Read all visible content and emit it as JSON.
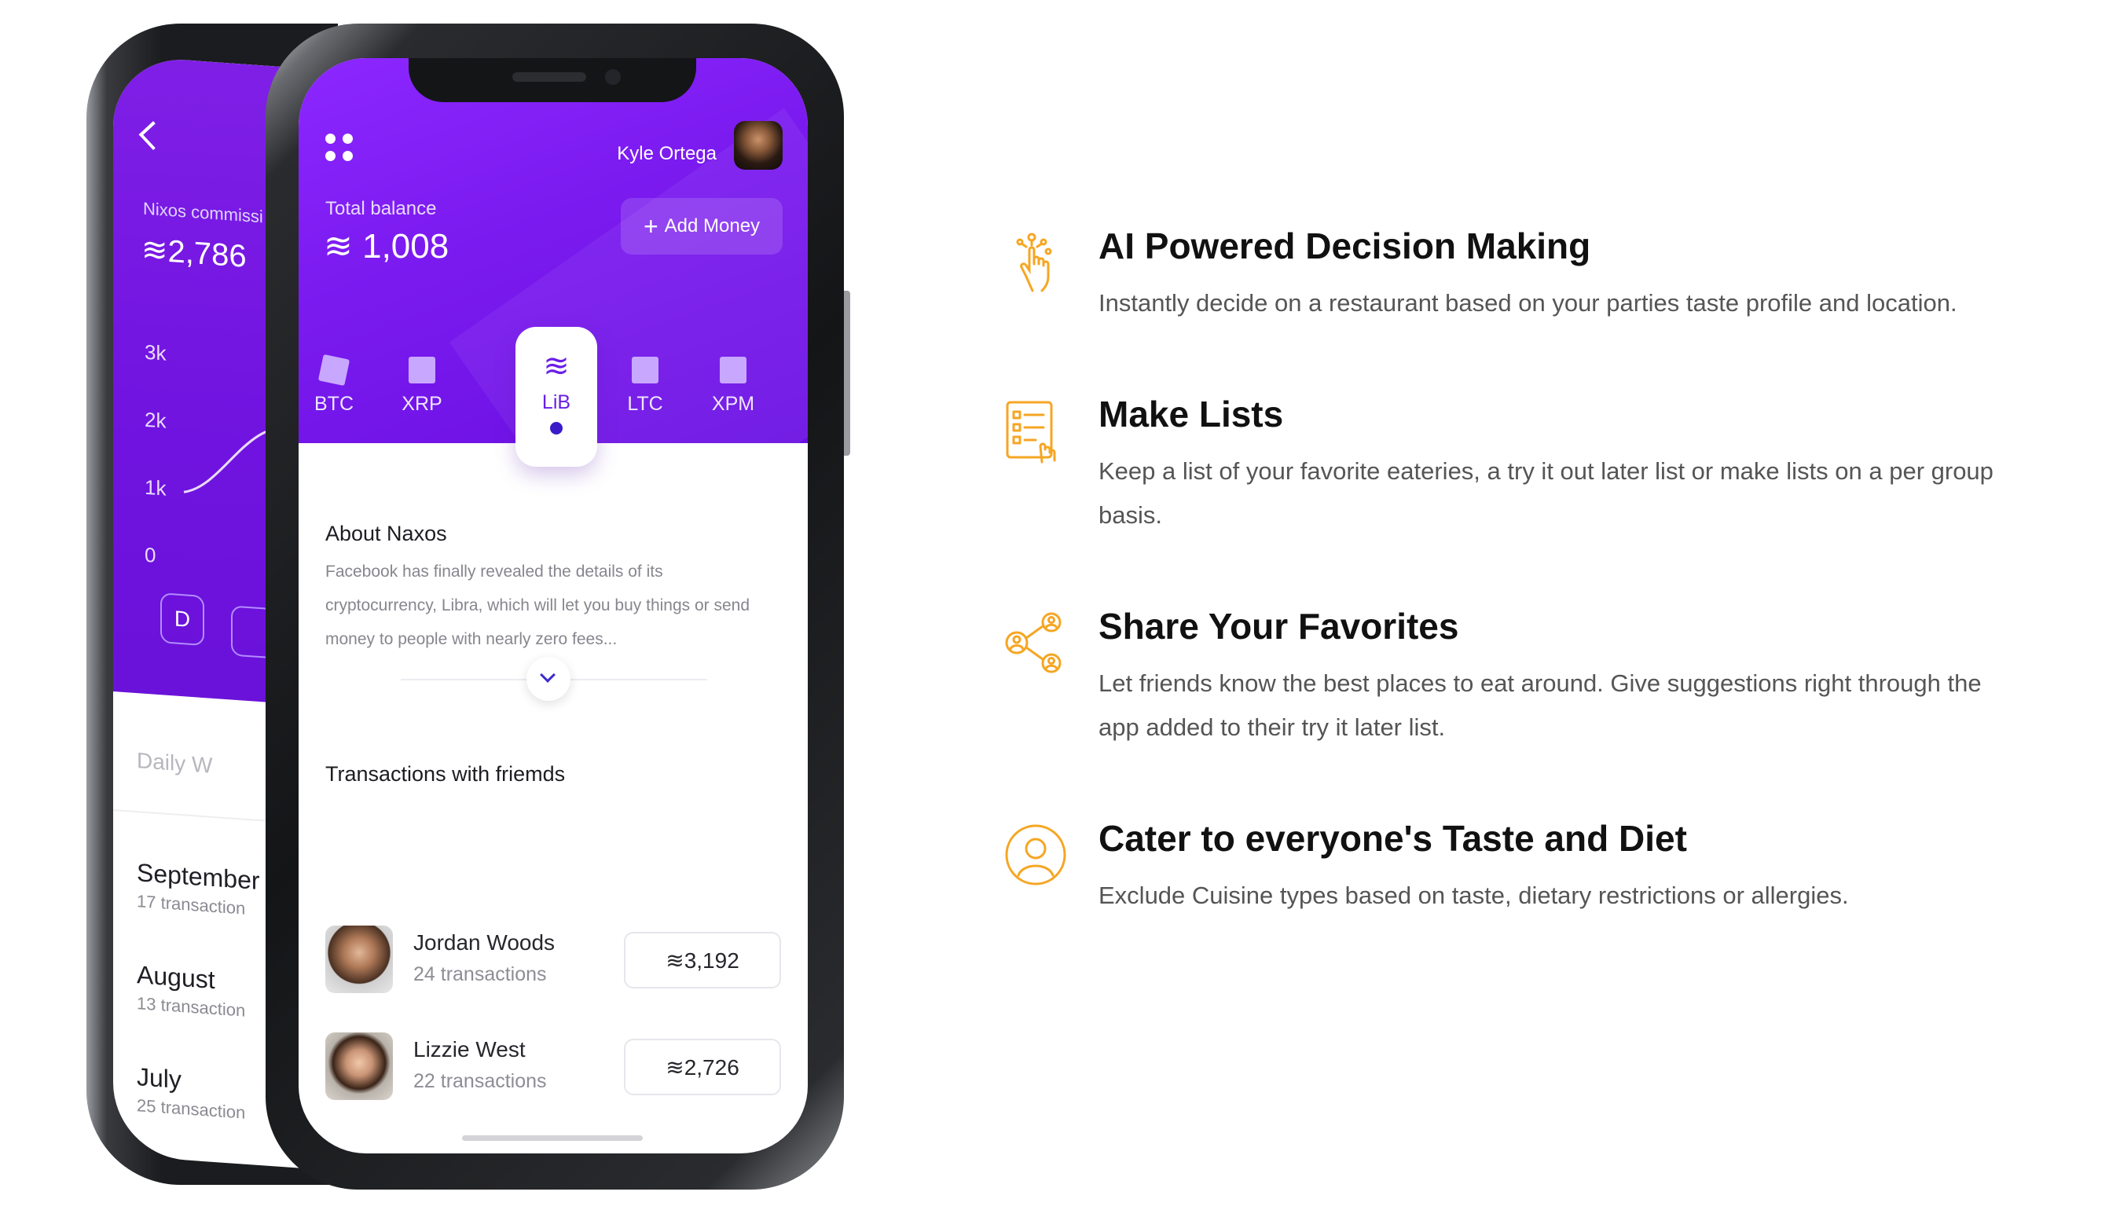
{
  "back_phone": {
    "label_small": "Nixos commissi",
    "balance": "≋2,786",
    "axis": [
      "3k",
      "2k",
      "1k",
      "0"
    ],
    "period_button": "D",
    "tabs": "Daily    W",
    "months": [
      {
        "name": "September",
        "count": "17 transaction"
      },
      {
        "name": "August",
        "count": "13 transaction"
      },
      {
        "name": "July",
        "count": "25 transaction"
      }
    ]
  },
  "front_phone": {
    "user_name": "Kyle Ortega",
    "total_label": "Total balance",
    "total_value": "≋ 1,008",
    "add_money": "Add Money",
    "coins": [
      "BTC",
      "XRP",
      "LiB",
      "LTC",
      "XPM"
    ],
    "lib_glyph": "≋",
    "about_title": "About Naxos",
    "about_text": "Facebook has finally revealed the details of its cryptocurrency, Libra, which will let you buy things or send money to people with nearly zero fees...",
    "transactions_title": "Transactions with friemds",
    "transactions": [
      {
        "name": "Jordan Woods",
        "count": "24 transactions",
        "amount": "≋3,192"
      },
      {
        "name": "Lizzie West",
        "count": "22 transactions",
        "amount": "≋2,726"
      }
    ]
  },
  "features": [
    {
      "icon": "hand-touch-icon",
      "title": "AI Powered Decision Making",
      "desc": "Instantly decide on a restaurant based on your parties taste profile and location."
    },
    {
      "icon": "checklist-icon",
      "title": "Make Lists",
      "desc": "Keep a list of your favorite eateries, a try it out later list or make lists on a per group basis."
    },
    {
      "icon": "share-people-icon",
      "title": "Share Your Favorites",
      "desc": "Let friends know the best places to eat around. Give suggestions right through the app added to their try it later list."
    },
    {
      "icon": "user-circle-icon",
      "title": "Cater to everyone's Taste and Diet",
      "desc": "Exclude Cuisine types based on taste, dietary restrictions or allergies."
    }
  ],
  "colors": {
    "accent_purple": "#7a1aef",
    "icon_orange": "#f5a623"
  }
}
